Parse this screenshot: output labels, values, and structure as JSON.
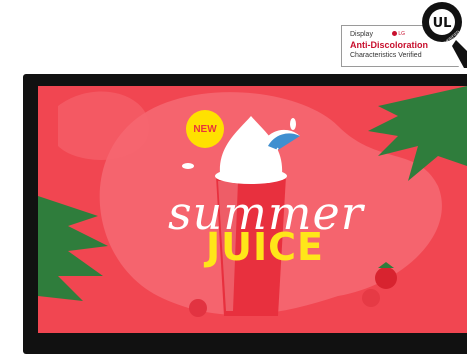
{
  "badge": {
    "lg_label": "LG",
    "line1": "Display",
    "line2": "Anti-Discoloration",
    "line3": "Characteristics Verified",
    "ul_logo": "UL",
    "ul_ring_text": "VERIFIED"
  },
  "promo": {
    "new_label": "NEW",
    "headline_script": "summer",
    "headline_bold": "JUICE"
  },
  "colors": {
    "screen_bg": "#f14651",
    "blob": "#f7707a",
    "juice": "#e8303e",
    "accent_yellow": "#ffe619",
    "leaf": "#2f7d3c"
  },
  "icons": [
    "ul-verified-mark-icon",
    "lg-logo-icon",
    "umbrella-icon",
    "strawberry-icon",
    "palm-leaf-icon"
  ]
}
